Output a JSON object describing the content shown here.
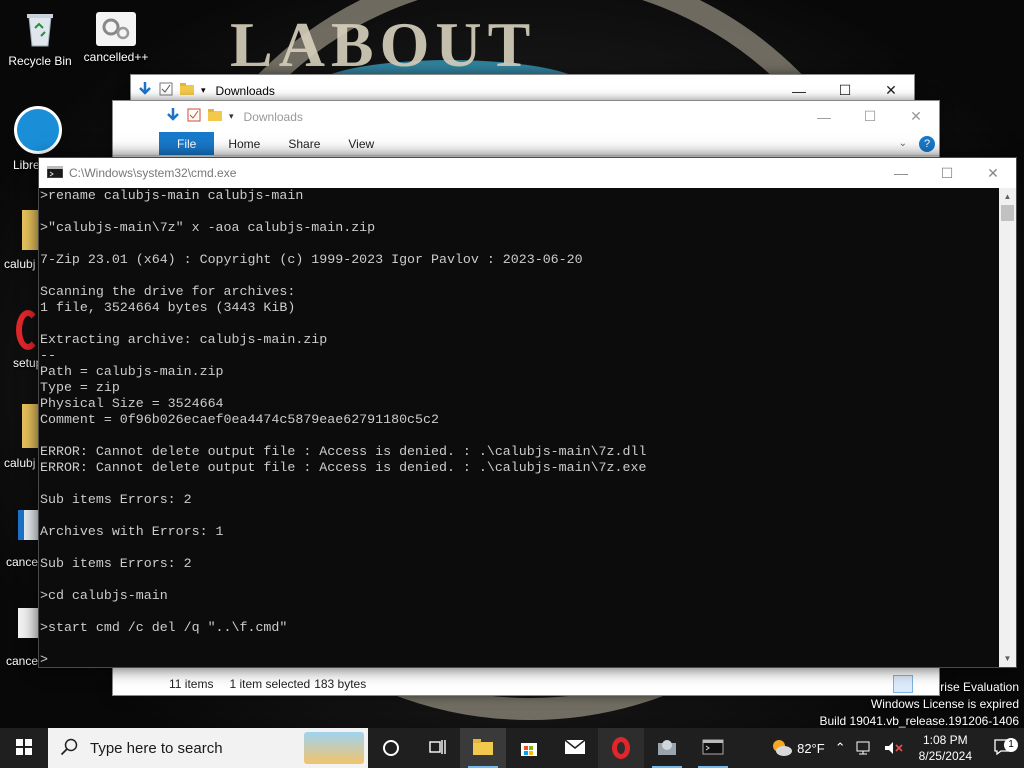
{
  "desktop": {
    "icons": [
      {
        "label": "Recycle Bin"
      },
      {
        "label": "cancelled++"
      }
    ],
    "partial_labels": [
      "Libre",
      "calubj",
      "setup",
      "calubj",
      "cancel",
      "cancel"
    ]
  },
  "explorer_back": {
    "title": "Downloads"
  },
  "explorer_front": {
    "title": "Downloads",
    "ribbon_tabs": [
      "File",
      "Home",
      "Share",
      "View"
    ],
    "status": {
      "items": "11 items",
      "selected": "1 item selected",
      "size": "183 bytes"
    }
  },
  "cmd": {
    "title": "C:\\Windows\\system32\\cmd.exe",
    "lines": [
      ">rename calubjs-main calubjs-main",
      "",
      ">\"calubjs-main\\7z\" x -aoa calubjs-main.zip",
      "",
      "7-Zip 23.01 (x64) : Copyright (c) 1999-2023 Igor Pavlov : 2023-06-20",
      "",
      "Scanning the drive for archives:",
      "1 file, 3524664 bytes (3443 KiB)",
      "",
      "Extracting archive: calubjs-main.zip",
      "--",
      "Path = calubjs-main.zip",
      "Type = zip",
      "Physical Size = 3524664",
      "Comment = 0f96b026ecaef0ea4474c5879eae62791180c5c2",
      "",
      "ERROR: Cannot delete output file : Access is denied. : .\\calubjs-main\\7z.dll",
      "ERROR: Cannot delete output file : Access is denied. : .\\calubjs-main\\7z.exe",
      "",
      "Sub items Errors: 2",
      "",
      "Archives with Errors: 1",
      "",
      "Sub items Errors: 2",
      "",
      ">cd calubjs-main",
      "",
      ">start cmd /c del /q \"..\\f.cmd\"",
      "",
      ">"
    ]
  },
  "watermark": {
    "line1": "rise Evaluation",
    "line2": "Windows License is expired",
    "line3": "Build 19041.vb_release.191206-1406"
  },
  "taskbar": {
    "search_placeholder": "Type here to search",
    "weather": "82°F",
    "time": "1:08 PM",
    "date": "8/25/2024",
    "notification_count": "1"
  },
  "colors": {
    "console_bg": "#0c0c0c",
    "console_text": "#cccccc",
    "ribbon_file": "#1979ca",
    "taskbar": "#1f1f1f"
  }
}
